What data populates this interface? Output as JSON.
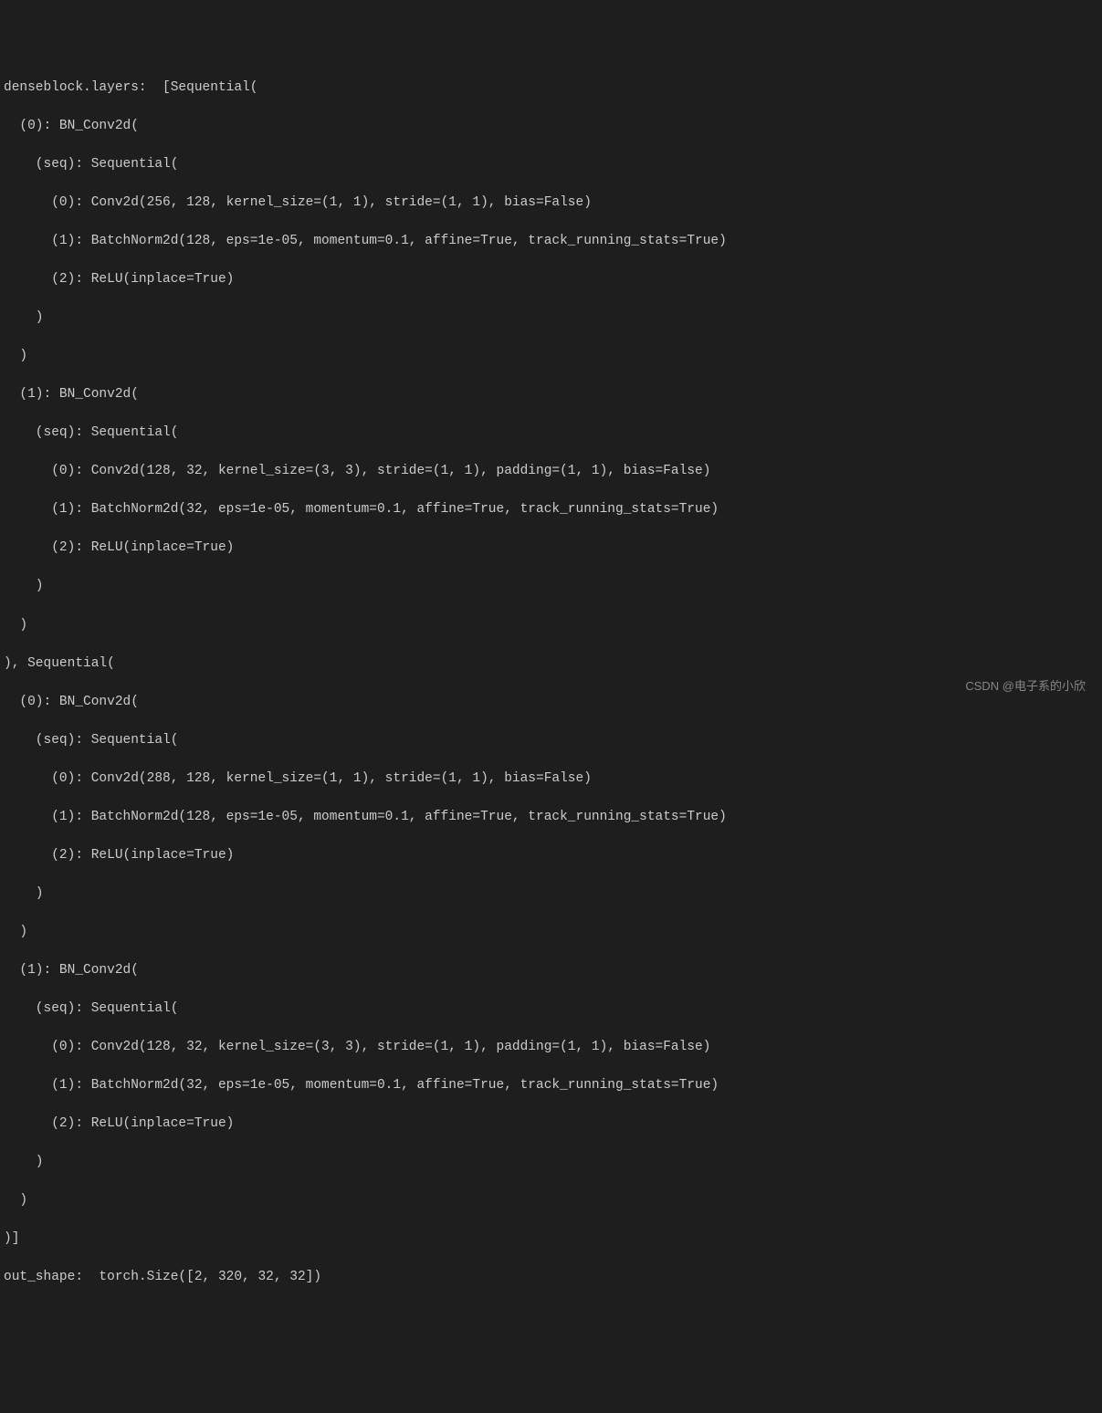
{
  "lines": {
    "l0": "denseblock.layers:  [Sequential(",
    "l1": "  (0): BN_Conv2d(",
    "l2": "    (seq): Sequential(",
    "l3": "      (0): Conv2d(256, 128, kernel_size=(1, 1), stride=(1, 1), bias=False)",
    "l4": "      (1): BatchNorm2d(128, eps=1e-05, momentum=0.1, affine=True, track_running_stats=True)",
    "l5": "      (2): ReLU(inplace=True)",
    "l6": "    )",
    "l7": "  )",
    "l8": "  (1): BN_Conv2d(",
    "l9": "    (seq): Sequential(",
    "l10": "      (0): Conv2d(128, 32, kernel_size=(3, 3), stride=(1, 1), padding=(1, 1), bias=False)",
    "l11": "      (1): BatchNorm2d(32, eps=1e-05, momentum=0.1, affine=True, track_running_stats=True)",
    "l12": "      (2): ReLU(inplace=True)",
    "l13": "    )",
    "l14": "  )",
    "l15": "), Sequential(",
    "l16": "  (0): BN_Conv2d(",
    "l17": "    (seq): Sequential(",
    "l18": "      (0): Conv2d(288, 128, kernel_size=(1, 1), stride=(1, 1), bias=False)",
    "l19": "      (1): BatchNorm2d(128, eps=1e-05, momentum=0.1, affine=True, track_running_stats=True)",
    "l20": "      (2): ReLU(inplace=True)",
    "l21": "    )",
    "l22": "  )",
    "l23": "  (1): BN_Conv2d(",
    "l24": "    (seq): Sequential(",
    "l25": "      (0): Conv2d(128, 32, kernel_size=(3, 3), stride=(1, 1), padding=(1, 1), bias=False)",
    "l26": "      (1): BatchNorm2d(32, eps=1e-05, momentum=0.1, affine=True, track_running_stats=True)",
    "l27": "      (2): ReLU(inplace=True)",
    "l28": "    )",
    "l29": "  )",
    "l30": ")]",
    "l31": "out_shape:  torch.Size([2, 320, 32, 32])"
  },
  "watermark": "CSDN @电子系的小欣"
}
